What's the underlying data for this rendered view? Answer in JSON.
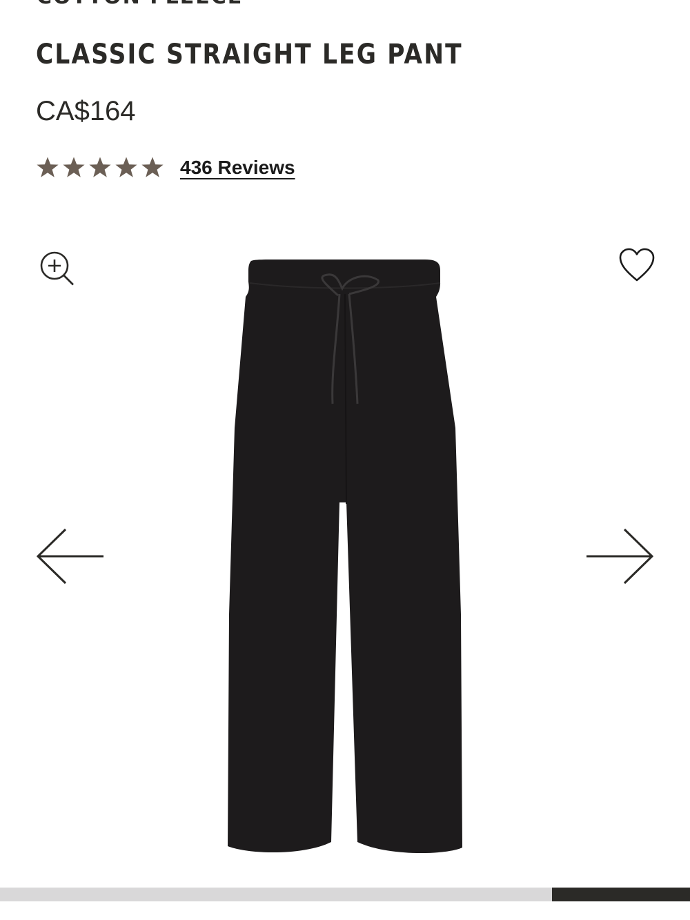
{
  "product": {
    "collection": "COTTON FLEECE",
    "title": "CLASSIC STRAIGHT LEG PANT",
    "price": "CA$164",
    "rating": 5,
    "reviews_label": "436 Reviews"
  },
  "gallery": {
    "image": "black-straight-leg-pant",
    "icons": [
      "zoom-in-icon",
      "heart-icon",
      "arrow-left-icon",
      "arrow-right-icon"
    ],
    "progress": {
      "start": 0.8,
      "end": 1.0
    }
  },
  "colors": {
    "star": "#6b5f55",
    "text": "#2b2a27",
    "track": "#d9d8d9",
    "fill": "#2b2a27",
    "product": "#1d1b1c"
  }
}
